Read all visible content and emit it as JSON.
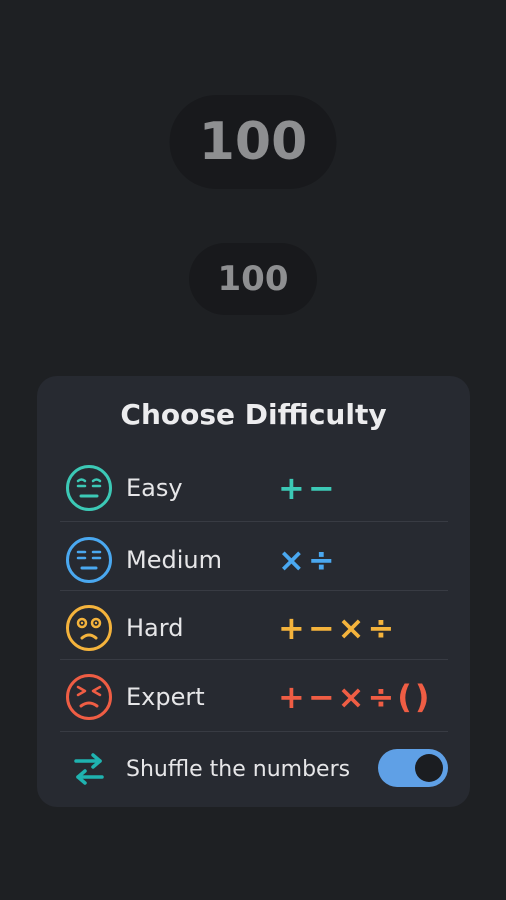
{
  "target": {
    "value": "100"
  },
  "current": {
    "value": "100"
  },
  "panel": {
    "title": "Choose Difficulty",
    "levels": [
      {
        "label": "Easy",
        "operators": "+−",
        "color": "#3cc9b6",
        "face": "meh-face-icon"
      },
      {
        "label": "Medium",
        "operators": "×÷",
        "color": "#4aa8f0",
        "face": "neutral-face-icon"
      },
      {
        "label": "Hard",
        "operators": "+−×÷",
        "color": "#f4b33c",
        "face": "worried-face-icon"
      },
      {
        "label": "Expert",
        "operators": "+−×÷()",
        "color": "#ef5d44",
        "face": "angry-face-icon"
      }
    ],
    "shuffle": {
      "label": "Shuffle the numbers",
      "enabled": true,
      "icon": "swap-arrows-icon",
      "icon_color": "#1fb3b0",
      "toggle_color": "#5fa0e6"
    }
  }
}
